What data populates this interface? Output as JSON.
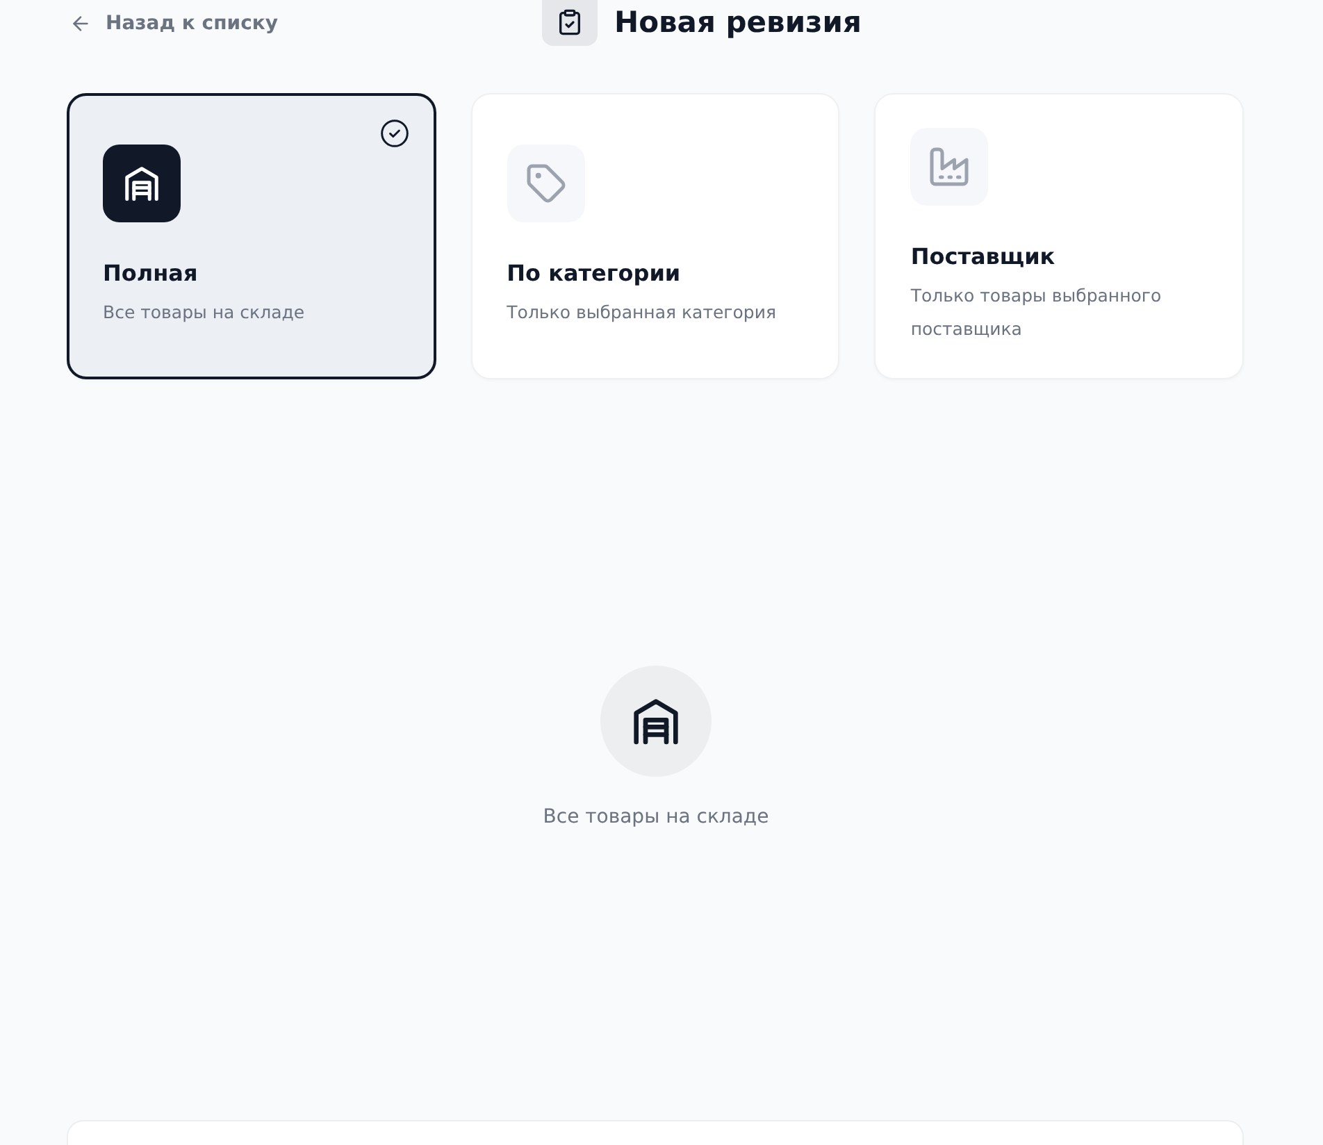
{
  "header": {
    "back_link": "Назад к списку",
    "title": "Новая ревизия"
  },
  "scope_options": [
    {
      "kind": "warehouse",
      "title": "Полная",
      "description": "Все товары на складе",
      "selected": true
    },
    {
      "kind": "category",
      "title": "По категории",
      "description": "Только выбранная категория",
      "selected": false
    },
    {
      "kind": "supplier",
      "title": "Поставщик",
      "description": "Только товары выбранного поставщика",
      "selected": false
    }
  ],
  "preview": {
    "kind": "warehouse",
    "caption": "Все товары на складе"
  }
}
